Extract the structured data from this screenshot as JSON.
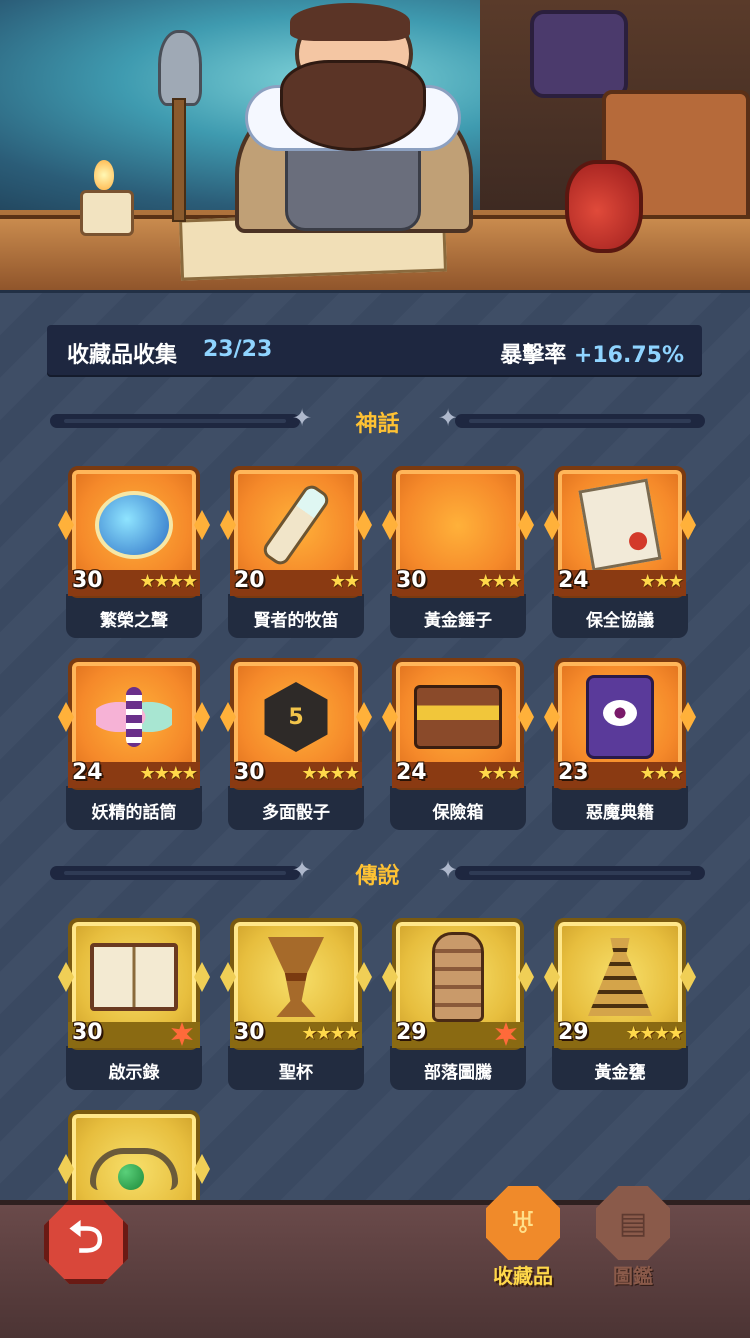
{
  "summary": {
    "label": "收藏品收集",
    "count": "23/23",
    "crit_label": "暴擊率",
    "crit_value": "+16.75%"
  },
  "sections": {
    "mythic_title": "神話",
    "legendary_title": "傳說"
  },
  "mythic_items": [
    {
      "level": "30",
      "stars_filled": 4,
      "stars_total": 4,
      "name": "繁榮之聲",
      "icon": "orb-icon"
    },
    {
      "level": "20",
      "stars_filled": 2,
      "stars_total": 2,
      "name": "賢者的牧笛",
      "icon": "flute-icon"
    },
    {
      "level": "30",
      "stars_filled": 3,
      "stars_total": 3,
      "name": "黃金錘子",
      "icon": "hammer-icon"
    },
    {
      "level": "24",
      "stars_filled": 3,
      "stars_total": 3,
      "name": "保全協議",
      "icon": "contract-icon"
    },
    {
      "level": "24",
      "stars_filled": 4,
      "stars_total": 4,
      "name": "妖精的話筒",
      "icon": "fairy-mic-icon"
    },
    {
      "level": "30",
      "stars_filled": 4,
      "stars_total": 4,
      "name": "多面骰子",
      "icon": "dice-icon"
    },
    {
      "level": "24",
      "stars_filled": 3,
      "stars_total": 3,
      "name": "保險箱",
      "icon": "treasure-box-icon"
    },
    {
      "level": "23",
      "stars_filled": 3,
      "stars_total": 3,
      "name": "惡魔典籍",
      "icon": "demon-tome-icon"
    }
  ],
  "legendary_items": [
    {
      "level": "30",
      "burst": true,
      "name": "啟示錄",
      "icon": "book-icon"
    },
    {
      "level": "30",
      "stars_filled": 4,
      "stars_total": 4,
      "name": "聖杯",
      "icon": "grail-icon"
    },
    {
      "level": "29",
      "burst": true,
      "name": "部落圖騰",
      "icon": "totem-icon"
    },
    {
      "level": "29",
      "stars_filled": 4,
      "stars_total": 4,
      "name": "黃金甕",
      "icon": "golden-jar-icon"
    },
    {
      "level": "",
      "name": "",
      "icon": "clover-ring-icon"
    }
  ],
  "bottom_nav": {
    "back_icon": "back-arrow-icon",
    "collection_label": "收藏品",
    "codex_label": "圖鑑"
  }
}
